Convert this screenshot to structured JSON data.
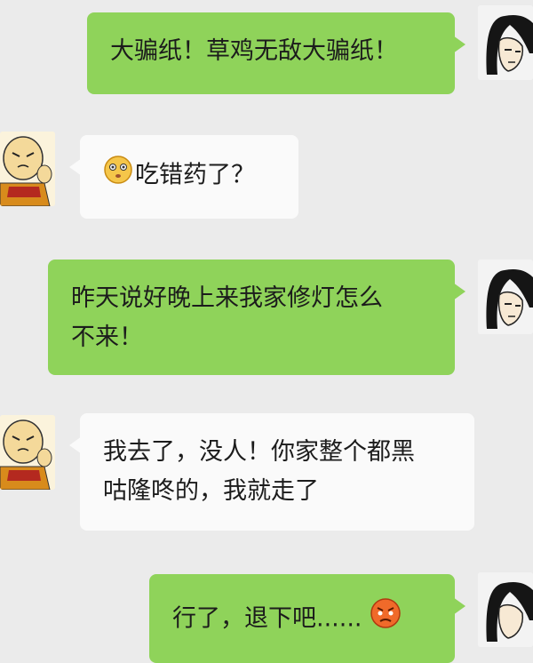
{
  "messages": [
    {
      "sender": "me",
      "text": "大骗纸！草鸡无敌大骗纸！"
    },
    {
      "sender": "other",
      "emoji": "worried-face-icon",
      "text": "吃错药了？"
    },
    {
      "sender": "me",
      "line1": "昨天说好晚上来我家修灯怎么",
      "line2": "不来！"
    },
    {
      "sender": "other",
      "line1": "我去了，没人！你家整个都黑",
      "line2": "咕隆咚的，我就走了"
    },
    {
      "sender": "me",
      "text": "行了，退下吧......",
      "emoji": "angry-face-icon"
    }
  ],
  "colors": {
    "background": "#ebebeb",
    "me_bubble": "#8fd35a",
    "other_bubble": "#fafafa"
  }
}
